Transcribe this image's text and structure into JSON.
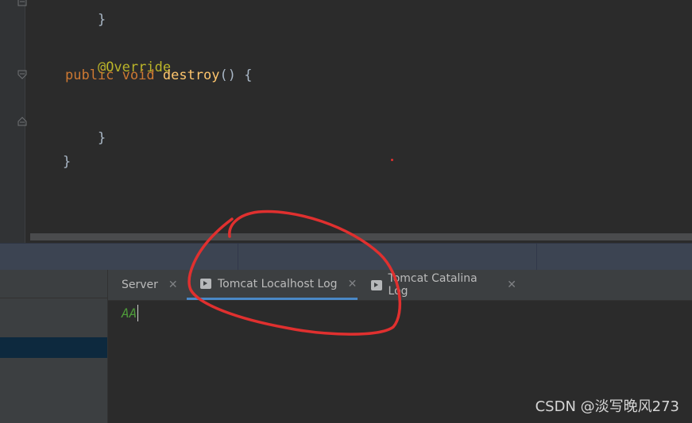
{
  "editor": {
    "lines": {
      "brace_inner_top": "}",
      "annotation": "@Override",
      "kw_public": "public",
      "kw_void": "void",
      "method_name": "destroy",
      "method_tail": "() {",
      "brace_inner_bottom": "}",
      "brace_class": "}"
    }
  },
  "tabs": [
    {
      "label": "Server",
      "close": "✕",
      "active": false
    },
    {
      "label": "Tomcat Localhost Log",
      "close": "✕",
      "active": true
    },
    {
      "label": "Tomcat Catalina Log",
      "close": "✕",
      "active": false
    }
  ],
  "console": {
    "output": "AA"
  },
  "watermark": "CSDN @淡写晚风273",
  "colors": {
    "editor_bg": "#2b2b2b",
    "keyword": "#cc7832",
    "annotation": "#bbb529",
    "function": "#ffc66d",
    "active_tab_underline": "#4a88c7",
    "console_text": "#4e9a3a",
    "annotation_circle": "#e0302f"
  },
  "icons": {
    "fold_marker": "fold-marker-icon",
    "tab_console": "console-tab-icon",
    "tab_close": "close-icon"
  }
}
